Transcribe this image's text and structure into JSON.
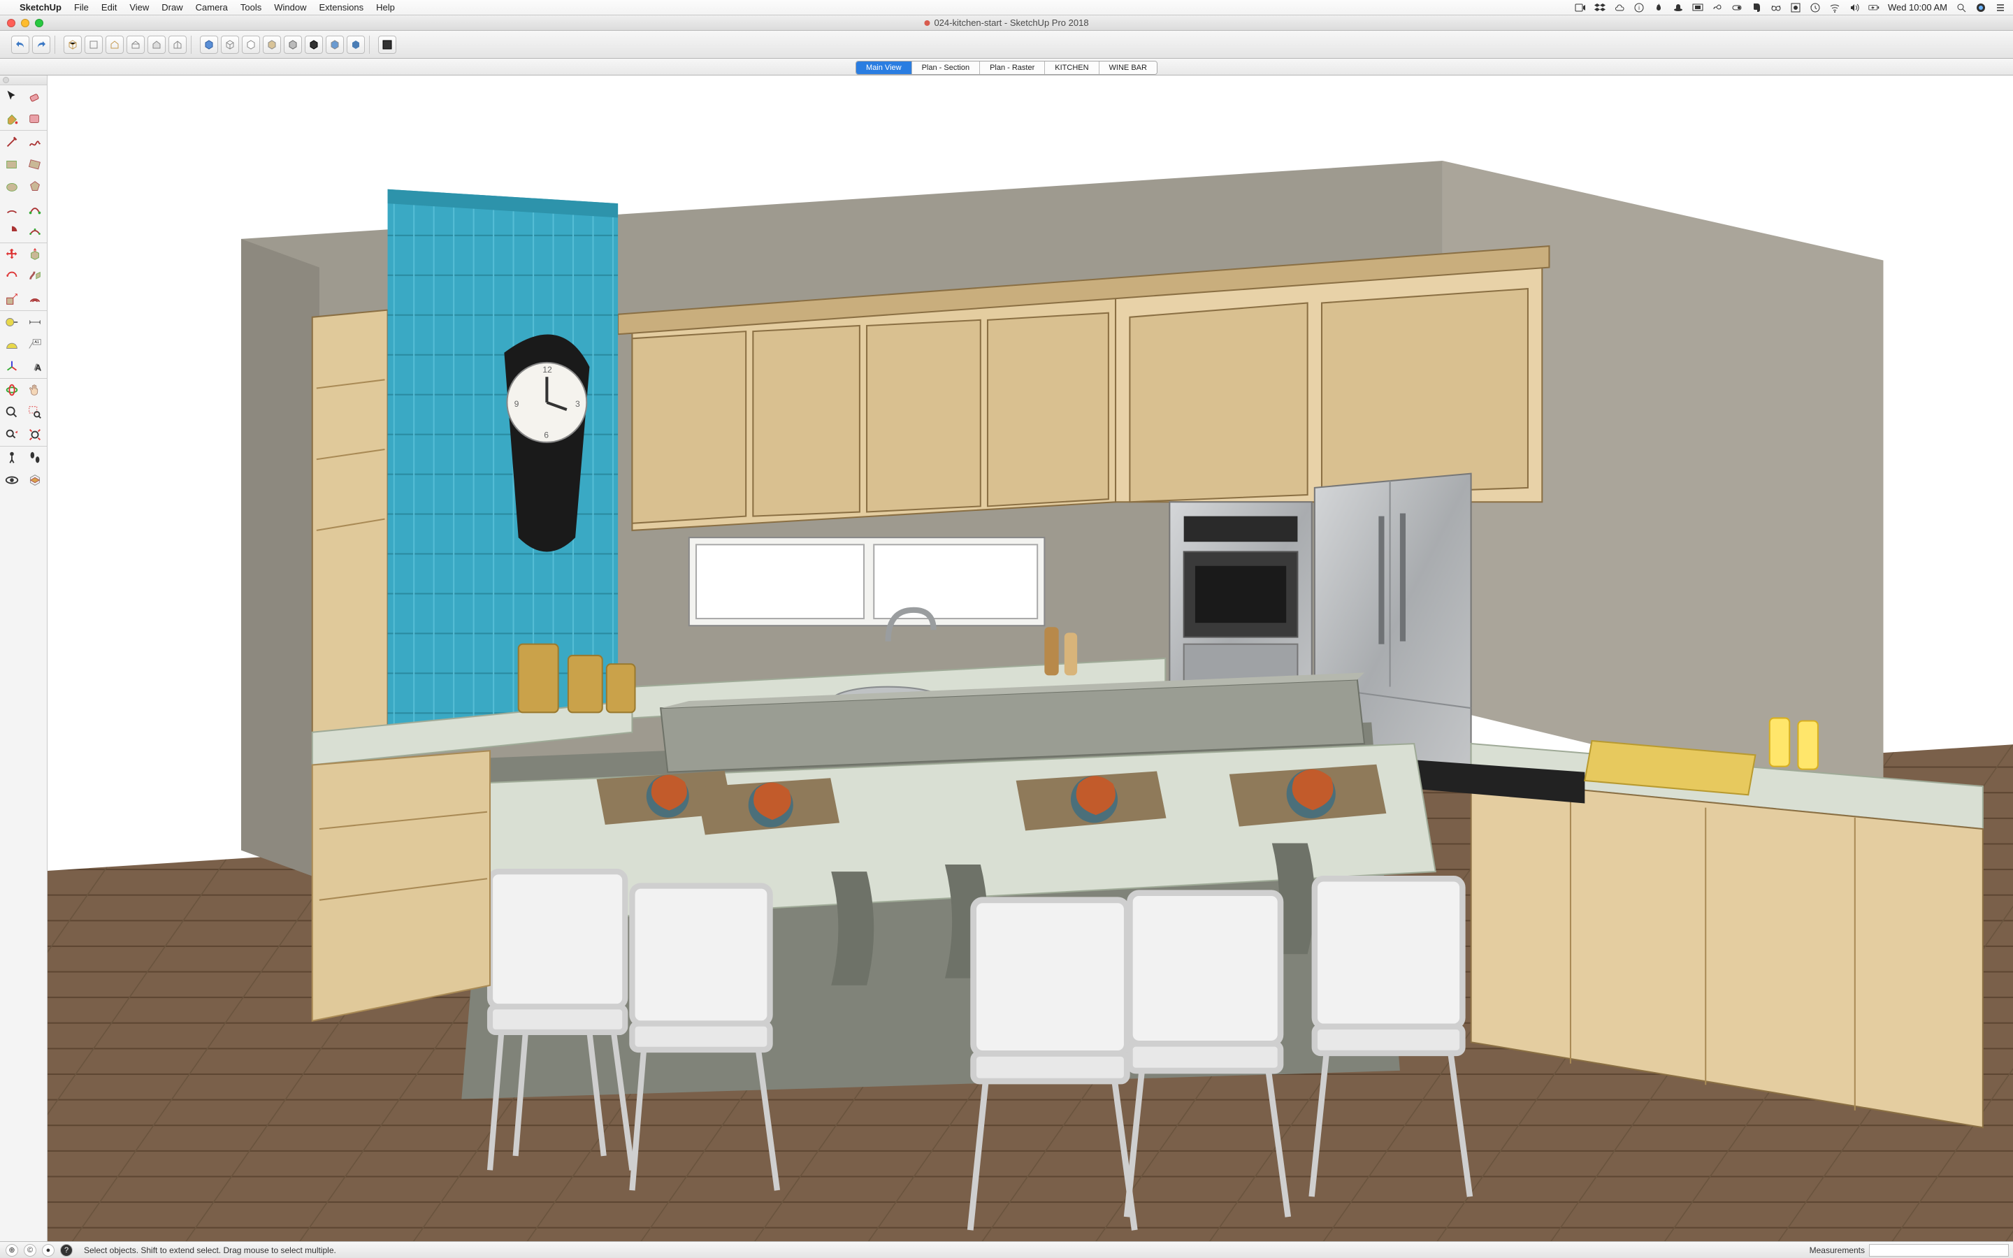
{
  "os": {
    "menus": [
      "File",
      "Edit",
      "View",
      "Draw",
      "Camera",
      "Tools",
      "Window",
      "Extensions",
      "Help"
    ],
    "appname": "SketchUp",
    "clock": "Wed 10:00 AM",
    "right_icons": [
      "screen-record-icon",
      "dropbox-icon",
      "cloud-icon",
      "info-icon",
      "flame-icon",
      "hat-icon",
      "displays-icon",
      "infinity-icon",
      "switch-icon",
      "evernote-icon",
      "glasses-icon",
      "record-icon",
      "time-machine-icon",
      "wifi-icon",
      "volume-icon",
      "battery-icon"
    ]
  },
  "window": {
    "title": "024-kitchen-start - SketchUp Pro 2018"
  },
  "toolbar": {
    "groups": [
      [
        "undo-icon",
        "redo-icon"
      ],
      [
        "model-box-icon",
        "component-icon",
        "house-iso-icon",
        "house-front-icon",
        "house-top-icon",
        "house-right-icon"
      ],
      [
        "style-shaded-icon",
        "style-wire-icon",
        "style-hidden-icon",
        "style-back-icon",
        "style-mono-icon",
        "style-xray-icon",
        "style-texture-icon",
        "style-sky-icon"
      ],
      [
        "layers-icon"
      ]
    ]
  },
  "scenes": {
    "tabs": [
      {
        "label": "Main View",
        "active": true
      },
      {
        "label": "Plan - Section",
        "active": false
      },
      {
        "label": "Plan - Raster",
        "active": false
      },
      {
        "label": "KITCHEN",
        "active": false
      },
      {
        "label": "WINE BAR",
        "active": false
      }
    ]
  },
  "palette": {
    "rows": [
      [
        "select-tool",
        "eraser-tool"
      ],
      [
        "paint-bucket-tool",
        "material-tool"
      ],
      "---",
      [
        "line-tool",
        "freehand-tool"
      ],
      [
        "rectangle-tool",
        "rotated-rect-tool"
      ],
      [
        "circle-tool",
        "polygon-tool"
      ],
      [
        "arc-tool",
        "two-point-arc-tool"
      ],
      [
        "pie-tool",
        "three-point-arc-tool"
      ],
      "---",
      [
        "move-tool",
        "push-pull-tool"
      ],
      [
        "rotate-tool",
        "follow-me-tool"
      ],
      [
        "scale-tool",
        "offset-tool"
      ],
      "---",
      [
        "tape-measure-tool",
        "dimension-tool"
      ],
      [
        "protractor-tool",
        "text-tool"
      ],
      [
        "axes-tool",
        "3d-text-tool"
      ],
      "---",
      [
        "orbit-tool",
        "pan-tool"
      ],
      [
        "zoom-tool",
        "zoom-window-tool"
      ],
      [
        "previous-view-tool",
        "zoom-extents-tool"
      ],
      "---",
      [
        "position-camera-tool",
        "walk-tool"
      ],
      [
        "look-around-tool",
        "section-plane-tool"
      ]
    ]
  },
  "status": {
    "hint": "Select objects. Shift to extend select. Drag mouse to select multiple.",
    "measurements_label": "Measurements",
    "measurements_value": ""
  },
  "colors": {
    "accent": "#2a7de1",
    "wall": "#9e9a8f",
    "cabinet": "#e4cda0",
    "cabinet_shadow": "#bda276",
    "counter": "#d9dfd3",
    "island_body": "#808379",
    "floor": "#7a604a",
    "tile_accent": "#3aa9c4",
    "steel": "#b9bcbf"
  }
}
